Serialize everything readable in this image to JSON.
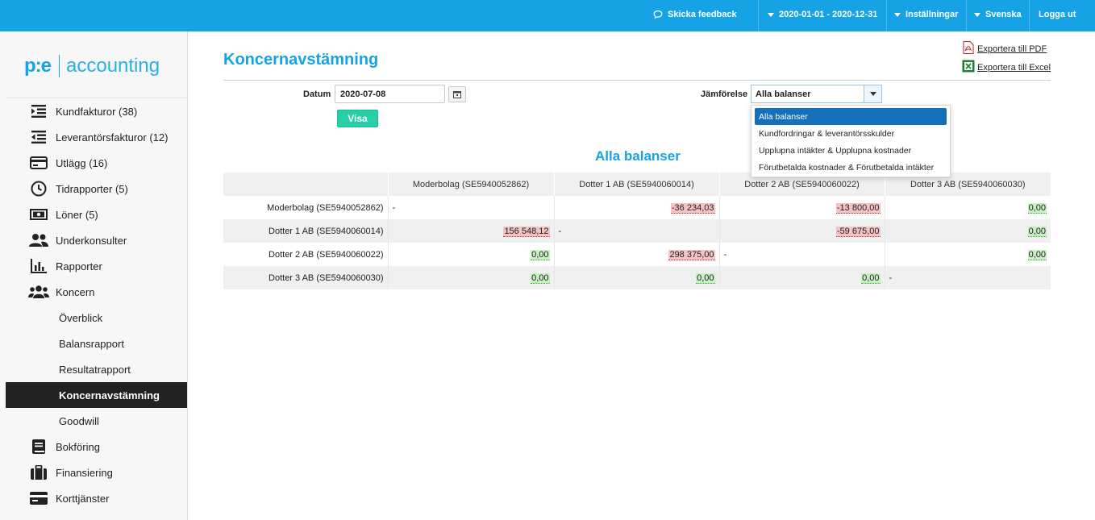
{
  "topbar": {
    "feedback": "Skicka feedback",
    "period": "2020-01-01 - 2020-12-31",
    "settings": "Inställningar",
    "language": "Svenska",
    "logout": "Logga ut"
  },
  "logo": {
    "pe": "p:e",
    "accounting": "accounting"
  },
  "sidebar": {
    "items": [
      {
        "label": "Kundfakturor (38)",
        "icon": "indent-icon"
      },
      {
        "label": "Leverantörsfakturor (12)",
        "icon": "outdent-icon"
      },
      {
        "label": "Utlägg (16)",
        "icon": "credit-card-icon"
      },
      {
        "label": "Tidrapporter (5)",
        "icon": "clock-icon"
      },
      {
        "label": "Löner (5)",
        "icon": "money-icon"
      },
      {
        "label": "Underkonsulter",
        "icon": "users-icon"
      },
      {
        "label": "Rapporter",
        "icon": "bar-chart-icon"
      },
      {
        "label": "Koncern",
        "icon": "group-icon"
      }
    ],
    "sub": [
      {
        "label": "Överblick"
      },
      {
        "label": "Balansrapport"
      },
      {
        "label": "Resultatrapport"
      },
      {
        "label": "Koncernavstämning"
      },
      {
        "label": "Goodwill"
      }
    ],
    "bottom": [
      {
        "label": "Bokföring",
        "icon": "book-icon"
      },
      {
        "label": "Finansiering",
        "icon": "briefcase-icon"
      },
      {
        "label": "Korttjänster",
        "icon": "card-icon"
      }
    ]
  },
  "page": {
    "title": "Koncernavstämning",
    "export_pdf": "Exportera till PDF",
    "export_excel": "Exportera till Excel",
    "date_label": "Datum",
    "date_value": "2020-07-08",
    "show_button": "Visa",
    "compare_label": "Jämförelse",
    "compare_value": "Alla balanser",
    "options": [
      "Alla balanser",
      "Kundfordringar & leverantörsskulder",
      "Upplupna intäkter & Upplupna kostnader",
      "Förutbetalda kostnader & Förutbetalda intäkter"
    ],
    "subtitle": "Alla balanser"
  },
  "table": {
    "columns": [
      "",
      "Moderbolag (SE5940052862)",
      "Dotter 1 AB (SE5940060014)",
      "Dotter 2 AB (SE5940060022)",
      "Dotter 3 AB (SE5940060030)"
    ],
    "rows": [
      {
        "label": "Moderbolag (SE5940052862)",
        "cells": [
          {
            "v": "-",
            "t": "dash"
          },
          {
            "v": "-36 234,03",
            "t": "neg"
          },
          {
            "v": "-13 800,00",
            "t": "neg"
          },
          {
            "v": "0,00",
            "t": "pos"
          }
        ]
      },
      {
        "label": "Dotter 1 AB (SE5940060014)",
        "cells": [
          {
            "v": "156 548,12",
            "t": "neg"
          },
          {
            "v": "-",
            "t": "dash"
          },
          {
            "v": "-59 675,00",
            "t": "neg"
          },
          {
            "v": "0,00",
            "t": "pos"
          }
        ]
      },
      {
        "label": "Dotter 2 AB (SE5940060022)",
        "cells": [
          {
            "v": "0,00",
            "t": "pos"
          },
          {
            "v": "298 375,00",
            "t": "neg"
          },
          {
            "v": "-",
            "t": "dash"
          },
          {
            "v": "0,00",
            "t": "pos"
          }
        ]
      },
      {
        "label": "Dotter 3 AB (SE5940060030)",
        "cells": [
          {
            "v": "0,00",
            "t": "pos"
          },
          {
            "v": "0,00",
            "t": "pos"
          },
          {
            "v": "0,00",
            "t": "pos"
          },
          {
            "v": "-",
            "t": "dash"
          }
        ]
      }
    ]
  },
  "colors": {
    "brand": "#16a3e6",
    "active_nav": "#222222",
    "visa": "#26cfa7",
    "negative": "#f4c3c3",
    "positive": "#c9f0c2"
  }
}
